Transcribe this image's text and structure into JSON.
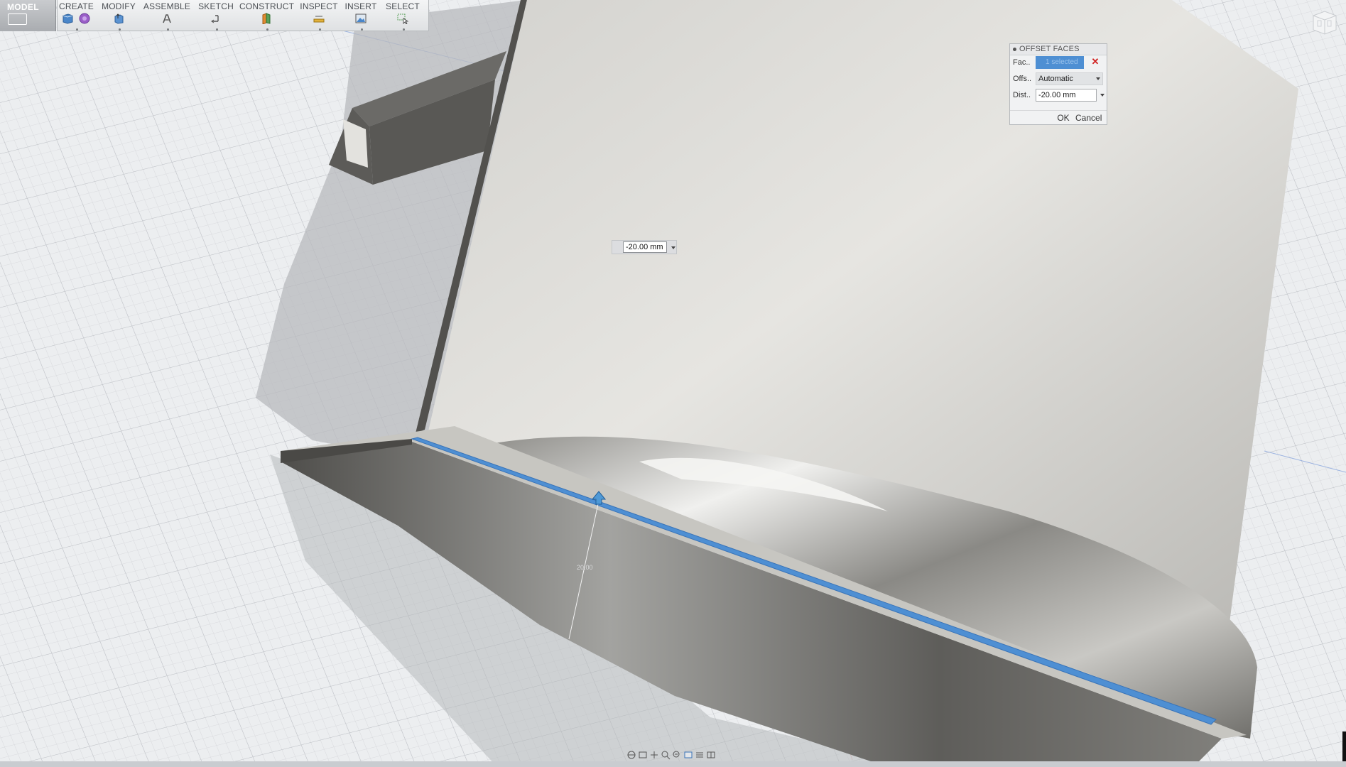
{
  "workspace": {
    "label": "MODEL"
  },
  "toolbar": {
    "groups": [
      {
        "label": "CREATE"
      },
      {
        "label": "MODIFY"
      },
      {
        "label": "ASSEMBLE"
      },
      {
        "label": "SKETCH"
      },
      {
        "label": "CONSTRUCT"
      },
      {
        "label": "INSPECT"
      },
      {
        "label": "INSERT"
      },
      {
        "label": "SELECT"
      }
    ]
  },
  "dialog": {
    "title": "OFFSET FACES",
    "faces_label": "Fac..",
    "faces_value": "1 selected",
    "offset_type_label": "Offs..",
    "offset_type_value": "Automatic",
    "distance_label": "Dist..",
    "distance_value": "-20.00 mm",
    "ok_label": "OK",
    "cancel_label": "Cancel"
  },
  "hud": {
    "distance_value": "-20.00 mm"
  },
  "dimension": {
    "label": "20.00"
  },
  "colors": {
    "selection": "#4e8fd3",
    "cancel_x": "#d02020"
  }
}
